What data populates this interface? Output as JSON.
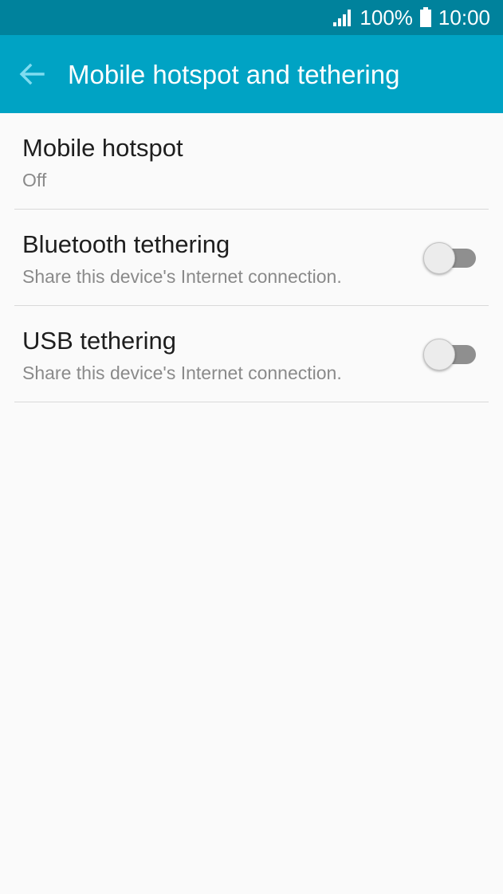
{
  "status_bar": {
    "battery_text": "100%",
    "time": "10:00",
    "icons": [
      "signal-icon",
      "battery-icon"
    ]
  },
  "app_bar": {
    "title": "Mobile hotspot and tethering",
    "back_icon": "arrow-left-icon"
  },
  "settings": [
    {
      "title": "Mobile hotspot",
      "subtitle": "Off"
    },
    {
      "title": "Bluetooth tethering",
      "subtitle": "Share this device's Internet connection.",
      "toggle_on": false
    },
    {
      "title": "USB tethering",
      "subtitle": "Share this device's Internet connection.",
      "toggle_on": false
    }
  ],
  "colors": {
    "status_bar": "#00829c",
    "app_bar": "#00a3c4",
    "back_arrow": "#7fdcf0",
    "background": "#fafafa",
    "toggle_track_off": "#8f8f8f"
  }
}
